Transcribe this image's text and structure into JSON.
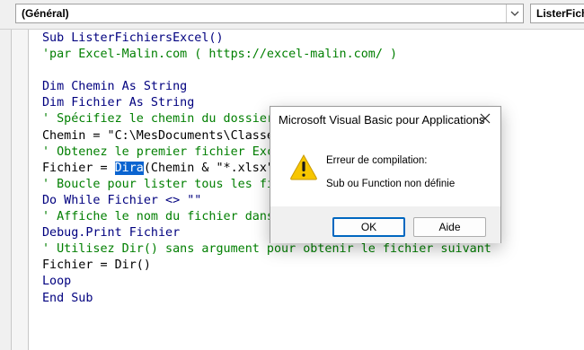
{
  "toolbar": {
    "object_combo": "(Général)",
    "procedure_combo": "ListerFichiersExcel"
  },
  "code_lines": [
    [
      {
        "t": "Sub ListerFichiersExcel()",
        "c": "kw"
      }
    ],
    [
      {
        "t": "'par Excel-Malin.com ( https://excel-malin.com/ )",
        "c": "cm"
      }
    ],
    [],
    [
      {
        "t": "Dim Chemin As String",
        "c": "kw"
      }
    ],
    [
      {
        "t": "Dim Fichier As String",
        "c": "kw"
      }
    ],
    [
      {
        "t": "' Spécifiez le chemin du dossier",
        "c": "cm"
      }
    ],
    [
      {
        "t": "Chemin = \"C:\\MesDocuments\\Classe",
        "c": ""
      }
    ],
    [
      {
        "t": "' Obtenez le premier fichier Exc",
        "c": "cm"
      }
    ],
    [
      {
        "t": "Fichier = ",
        "c": ""
      },
      {
        "t": "Dira",
        "c": "sel"
      },
      {
        "t": "(Chemin & \"*.xlsx\"",
        "c": ""
      }
    ],
    [
      {
        "t": "' Boucle pour lister tous les fi",
        "c": "cm"
      }
    ],
    [
      {
        "t": "Do While Fichier <> \"\"",
        "c": "kw"
      }
    ],
    [
      {
        "t": "' Affiche le nom du fichier dans",
        "c": "cm"
      }
    ],
    [
      {
        "t": "Debug.Print Fichier",
        "c": "kw"
      }
    ],
    [
      {
        "t": "' Utilisez Dir() sans argument pour obtenir le fichier suivant",
        "c": "cm"
      }
    ],
    [
      {
        "t": "Fichier = Dir()",
        "c": ""
      }
    ],
    [
      {
        "t": "Loop",
        "c": "kw"
      }
    ],
    [
      {
        "t": "End Sub",
        "c": "kw"
      }
    ]
  ],
  "dialog": {
    "title": "Microsoft Visual Basic pour Applications",
    "message_heading": "Erreur de compilation:",
    "message_detail": "Sub ou Function non définie",
    "ok_label": "OK",
    "help_label": "Aide",
    "icon": "warning-icon"
  },
  "colors": {
    "keyword": "#00007f",
    "comment": "#007f00",
    "selection": "#0a64d0",
    "ok_border": "#0067c0"
  }
}
